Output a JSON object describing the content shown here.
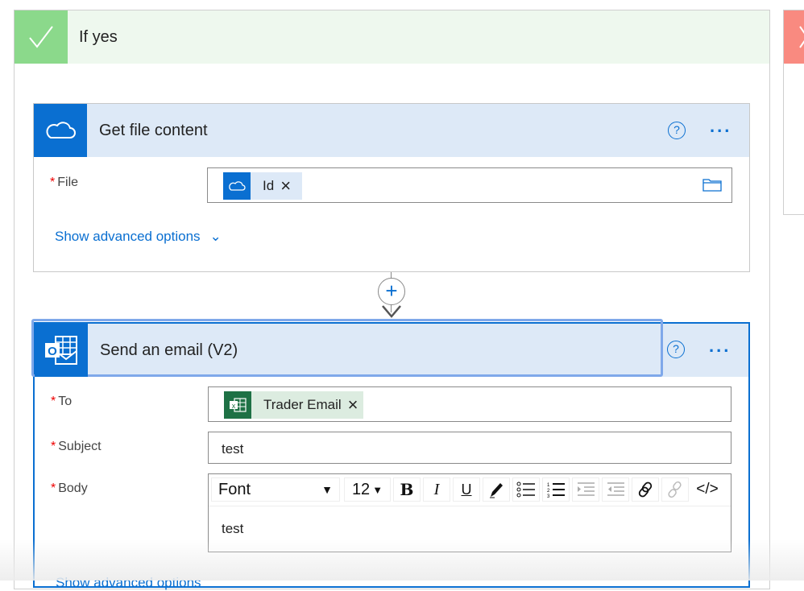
{
  "branch_yes": {
    "title": "If yes",
    "color": "#8bd98b",
    "icon": "check-icon"
  },
  "branch_no": {
    "color": "#f98a80",
    "icon": "close-icon"
  },
  "get_file": {
    "title": "Get file content",
    "icon": "onedrive-cloud-icon",
    "help": "?",
    "more": "...",
    "file_label": "File",
    "file_token": "Id",
    "remove": "×",
    "advanced": "Show advanced options"
  },
  "insert_step": {
    "icon": "plus-icon",
    "label": "+"
  },
  "send_email": {
    "title": "Send an email (V2)",
    "icon": "outlook-icon",
    "help": "?",
    "more": "...",
    "to_label": "To",
    "to_token": "Trader Email",
    "remove": "×",
    "subject_label": "Subject",
    "subject_value": "test",
    "body_label": "Body",
    "body_value": "test",
    "toolbar": {
      "font": "Font",
      "size": "12",
      "bold": "B",
      "italic": "I",
      "underline": "U",
      "code": "</>"
    },
    "advanced": "Show advanced options"
  },
  "colors": {
    "accent": "#0a6fd1",
    "header_bg": "#dde9f7",
    "excel": "#1e7145"
  }
}
